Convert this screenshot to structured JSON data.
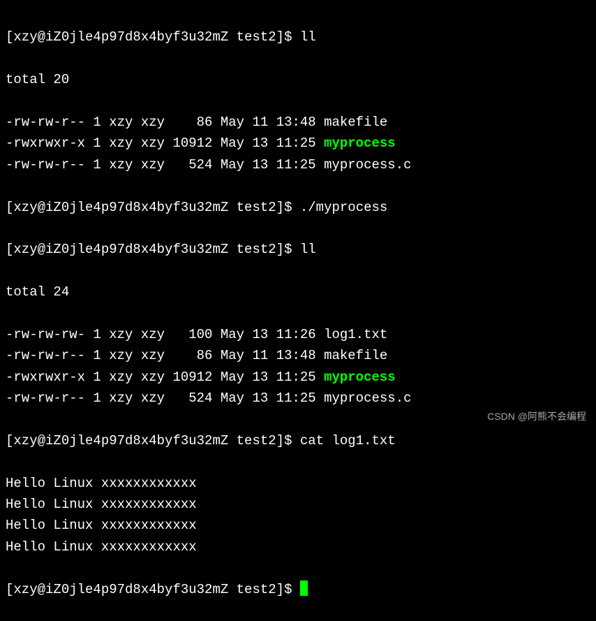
{
  "prompt": "[xzy@iZ0jle4p97d8x4byf3u32mZ test2]$ ",
  "commands": {
    "ll1": "ll",
    "run": "./myprocess",
    "ll2": "ll",
    "cat": "cat log1.txt",
    "empty": ""
  },
  "listing1": {
    "total": "total 20",
    "rows": [
      {
        "perms": "-rw-rw-r--",
        "links": "1",
        "owner": "xzy",
        "group": "xzy",
        "size": "   86",
        "month": "May",
        "day": "11",
        "time": "13:48",
        "name": "makefile",
        "exec": false
      },
      {
        "perms": "-rwxrwxr-x",
        "links": "1",
        "owner": "xzy",
        "group": "xzy",
        "size": "10912",
        "month": "May",
        "day": "13",
        "time": "11:25",
        "name": "myprocess",
        "exec": true
      },
      {
        "perms": "-rw-rw-r--",
        "links": "1",
        "owner": "xzy",
        "group": "xzy",
        "size": "  524",
        "month": "May",
        "day": "13",
        "time": "11:25",
        "name": "myprocess.c",
        "exec": false
      }
    ]
  },
  "listing2": {
    "total": "total 24",
    "rows": [
      {
        "perms": "-rw-rw-rw-",
        "links": "1",
        "owner": "xzy",
        "group": "xzy",
        "size": "  100",
        "month": "May",
        "day": "13",
        "time": "11:26",
        "name": "log1.txt",
        "exec": false
      },
      {
        "perms": "-rw-rw-r--",
        "links": "1",
        "owner": "xzy",
        "group": "xzy",
        "size": "   86",
        "month": "May",
        "day": "11",
        "time": "13:48",
        "name": "makefile",
        "exec": false
      },
      {
        "perms": "-rwxrwxr-x",
        "links": "1",
        "owner": "xzy",
        "group": "xzy",
        "size": "10912",
        "month": "May",
        "day": "13",
        "time": "11:25",
        "name": "myprocess",
        "exec": true
      },
      {
        "perms": "-rw-rw-r--",
        "links": "1",
        "owner": "xzy",
        "group": "xzy",
        "size": "  524",
        "month": "May",
        "day": "13",
        "time": "11:25",
        "name": "myprocess.c",
        "exec": false
      }
    ]
  },
  "cat_output": [
    "Hello Linux xxxxxxxxxxxx",
    "Hello Linux xxxxxxxxxxxx",
    "Hello Linux xxxxxxxxxxxx",
    "Hello Linux xxxxxxxxxxxx"
  ],
  "watermark": "CSDN @阿熊不会编程"
}
